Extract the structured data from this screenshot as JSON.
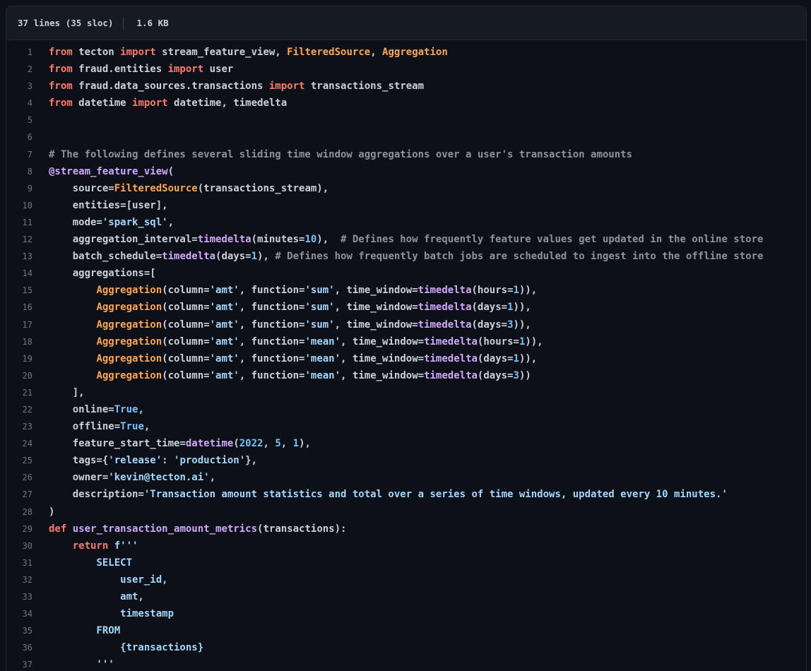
{
  "header": {
    "line_count": "37 lines (35 sloc)",
    "size": "1.6 KB"
  },
  "palette": {
    "page_background": "#0d1117",
    "header_background": "#161b22",
    "border": "#21262d",
    "default_text": "#c9d1d9",
    "line_number": "#6e7681",
    "keyword": "#ff7b72",
    "class_name": "#ffa657",
    "function_call": "#d2a8ff",
    "string": "#a5d6ff",
    "number_constant": "#79c0ff",
    "comment": "#8b949e"
  },
  "code": {
    "language": "python",
    "lines": [
      {
        "num": 1,
        "t": [
          [
            "k",
            "from"
          ],
          [
            "p",
            " tecton "
          ],
          [
            "k",
            "import"
          ],
          [
            "p",
            " stream_feature_view, "
          ],
          [
            "cls",
            "FilteredSource"
          ],
          [
            "p",
            ", "
          ],
          [
            "cls",
            "Aggregation"
          ]
        ]
      },
      {
        "num": 2,
        "t": [
          [
            "k",
            "from"
          ],
          [
            "p",
            " fraud.entities "
          ],
          [
            "k",
            "import"
          ],
          [
            "p",
            " user"
          ]
        ]
      },
      {
        "num": 3,
        "t": [
          [
            "k",
            "from"
          ],
          [
            "p",
            " fraud.data_sources.transactions "
          ],
          [
            "k",
            "import"
          ],
          [
            "p",
            " transactions_stream"
          ]
        ]
      },
      {
        "num": 4,
        "t": [
          [
            "k",
            "from"
          ],
          [
            "p",
            " datetime "
          ],
          [
            "k",
            "import"
          ],
          [
            "p",
            " datetime, timedelta"
          ]
        ]
      },
      {
        "num": 5,
        "t": []
      },
      {
        "num": 6,
        "t": []
      },
      {
        "num": 7,
        "t": [
          [
            "c",
            "# The following defines several sliding time window aggregations over a user's transaction amounts"
          ]
        ]
      },
      {
        "num": 8,
        "t": [
          [
            "fn",
            "@stream_feature_view"
          ],
          [
            "p",
            "("
          ]
        ]
      },
      {
        "num": 9,
        "t": [
          [
            "p",
            "    source="
          ],
          [
            "cls",
            "FilteredSource"
          ],
          [
            "p",
            "(transactions_stream),"
          ]
        ]
      },
      {
        "num": 10,
        "t": [
          [
            "p",
            "    entities=[user],"
          ]
        ]
      },
      {
        "num": 11,
        "t": [
          [
            "p",
            "    mode="
          ],
          [
            "s",
            "'spark_sql'"
          ],
          [
            "p",
            ","
          ]
        ]
      },
      {
        "num": 12,
        "t": [
          [
            "p",
            "    aggregation_interval="
          ],
          [
            "fn",
            "timedelta"
          ],
          [
            "p",
            "(minutes="
          ],
          [
            "n",
            "10"
          ],
          [
            "p",
            "),  "
          ],
          [
            "c",
            "# Defines how frequently feature values get updated in the online store"
          ]
        ]
      },
      {
        "num": 13,
        "t": [
          [
            "p",
            "    batch_schedule="
          ],
          [
            "fn",
            "timedelta"
          ],
          [
            "p",
            "(days="
          ],
          [
            "n",
            "1"
          ],
          [
            "p",
            "), "
          ],
          [
            "c",
            "# Defines how frequently batch jobs are scheduled to ingest into the offline store"
          ]
        ]
      },
      {
        "num": 14,
        "t": [
          [
            "p",
            "    aggregations=["
          ]
        ]
      },
      {
        "num": 15,
        "t": [
          [
            "p",
            "        "
          ],
          [
            "cls",
            "Aggregation"
          ],
          [
            "p",
            "(column="
          ],
          [
            "s",
            "'amt'"
          ],
          [
            "p",
            ", function="
          ],
          [
            "s",
            "'sum'"
          ],
          [
            "p",
            ", time_window="
          ],
          [
            "fn",
            "timedelta"
          ],
          [
            "p",
            "(hours="
          ],
          [
            "n",
            "1"
          ],
          [
            "p",
            ")),"
          ]
        ]
      },
      {
        "num": 16,
        "t": [
          [
            "p",
            "        "
          ],
          [
            "cls",
            "Aggregation"
          ],
          [
            "p",
            "(column="
          ],
          [
            "s",
            "'amt'"
          ],
          [
            "p",
            ", function="
          ],
          [
            "s",
            "'sum'"
          ],
          [
            "p",
            ", time_window="
          ],
          [
            "fn",
            "timedelta"
          ],
          [
            "p",
            "(days="
          ],
          [
            "n",
            "1"
          ],
          [
            "p",
            ")),"
          ]
        ]
      },
      {
        "num": 17,
        "t": [
          [
            "p",
            "        "
          ],
          [
            "cls",
            "Aggregation"
          ],
          [
            "p",
            "(column="
          ],
          [
            "s",
            "'amt'"
          ],
          [
            "p",
            ", function="
          ],
          [
            "s",
            "'sum'"
          ],
          [
            "p",
            ", time_window="
          ],
          [
            "fn",
            "timedelta"
          ],
          [
            "p",
            "(days="
          ],
          [
            "n",
            "3"
          ],
          [
            "p",
            ")),"
          ]
        ]
      },
      {
        "num": 18,
        "t": [
          [
            "p",
            "        "
          ],
          [
            "cls",
            "Aggregation"
          ],
          [
            "p",
            "(column="
          ],
          [
            "s",
            "'amt'"
          ],
          [
            "p",
            ", function="
          ],
          [
            "s",
            "'mean'"
          ],
          [
            "p",
            ", time_window="
          ],
          [
            "fn",
            "timedelta"
          ],
          [
            "p",
            "(hours="
          ],
          [
            "n",
            "1"
          ],
          [
            "p",
            ")),"
          ]
        ]
      },
      {
        "num": 19,
        "t": [
          [
            "p",
            "        "
          ],
          [
            "cls",
            "Aggregation"
          ],
          [
            "p",
            "(column="
          ],
          [
            "s",
            "'amt'"
          ],
          [
            "p",
            ", function="
          ],
          [
            "s",
            "'mean'"
          ],
          [
            "p",
            ", time_window="
          ],
          [
            "fn",
            "timedelta"
          ],
          [
            "p",
            "(days="
          ],
          [
            "n",
            "1"
          ],
          [
            "p",
            ")),"
          ]
        ]
      },
      {
        "num": 20,
        "t": [
          [
            "p",
            "        "
          ],
          [
            "cls",
            "Aggregation"
          ],
          [
            "p",
            "(column="
          ],
          [
            "s",
            "'amt'"
          ],
          [
            "p",
            ", function="
          ],
          [
            "s",
            "'mean'"
          ],
          [
            "p",
            ", time_window="
          ],
          [
            "fn",
            "timedelta"
          ],
          [
            "p",
            "(days="
          ],
          [
            "n",
            "3"
          ],
          [
            "p",
            "))"
          ]
        ]
      },
      {
        "num": 21,
        "t": [
          [
            "p",
            "    ],"
          ]
        ]
      },
      {
        "num": 22,
        "t": [
          [
            "p",
            "    online="
          ],
          [
            "n",
            "True"
          ],
          [
            "p",
            ","
          ]
        ]
      },
      {
        "num": 23,
        "t": [
          [
            "p",
            "    offline="
          ],
          [
            "n",
            "True"
          ],
          [
            "p",
            ","
          ]
        ]
      },
      {
        "num": 24,
        "t": [
          [
            "p",
            "    feature_start_time="
          ],
          [
            "fn",
            "datetime"
          ],
          [
            "p",
            "("
          ],
          [
            "n",
            "2022"
          ],
          [
            "p",
            ", "
          ],
          [
            "n",
            "5"
          ],
          [
            "p",
            ", "
          ],
          [
            "n",
            "1"
          ],
          [
            "p",
            "),"
          ]
        ]
      },
      {
        "num": 25,
        "t": [
          [
            "p",
            "    tags={"
          ],
          [
            "s",
            "'release'"
          ],
          [
            "p",
            ": "
          ],
          [
            "s",
            "'production'"
          ],
          [
            "p",
            "},"
          ]
        ]
      },
      {
        "num": 26,
        "t": [
          [
            "p",
            "    owner="
          ],
          [
            "s",
            "'kevin@tecton.ai'"
          ],
          [
            "p",
            ","
          ]
        ]
      },
      {
        "num": 27,
        "t": [
          [
            "p",
            "    description="
          ],
          [
            "s",
            "'Transaction amount statistics and total over a series of time windows, updated every 10 minutes.'"
          ]
        ]
      },
      {
        "num": 28,
        "t": [
          [
            "p",
            ")"
          ]
        ]
      },
      {
        "num": 29,
        "t": [
          [
            "k",
            "def"
          ],
          [
            "p",
            " "
          ],
          [
            "fn",
            "user_transaction_amount_metrics"
          ],
          [
            "p",
            "(transactions):"
          ]
        ]
      },
      {
        "num": 30,
        "t": [
          [
            "p",
            "    "
          ],
          [
            "k",
            "return"
          ],
          [
            "p",
            " "
          ],
          [
            "s",
            "f'''"
          ]
        ]
      },
      {
        "num": 31,
        "t": [
          [
            "s",
            "        SELECT"
          ]
        ]
      },
      {
        "num": 32,
        "t": [
          [
            "s",
            "            user_id,"
          ]
        ]
      },
      {
        "num": 33,
        "t": [
          [
            "s",
            "            amt,"
          ]
        ]
      },
      {
        "num": 34,
        "t": [
          [
            "s",
            "            timestamp"
          ]
        ]
      },
      {
        "num": 35,
        "t": [
          [
            "s",
            "        FROM"
          ]
        ]
      },
      {
        "num": 36,
        "t": [
          [
            "s",
            "            {transactions}"
          ]
        ]
      },
      {
        "num": 37,
        "t": [
          [
            "s",
            "        '''"
          ]
        ]
      }
    ]
  }
}
